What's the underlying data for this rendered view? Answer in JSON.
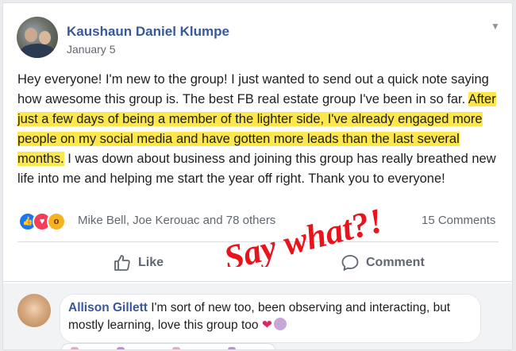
{
  "post": {
    "author": "Kaushaun Daniel Klumpe",
    "date": "January 5",
    "text_before": "Hey everyone! I'm new to the group! I just wanted to send out a quick note saying how awesome this group is. The best FB real estate group I've been in so far. ",
    "text_highlight": "After just a few days of being a member of the lighter side, I've already engaged more people on my social media and have gotten more leads than the last several months.",
    "text_after": " I was down about business and joining this group has really breathed new life into me and helping me start the year off right. Thank you to everyone!",
    "highlight_color": "#fde74c"
  },
  "reactions": {
    "types": [
      "like",
      "love",
      "wow"
    ],
    "names": "Mike Bell, Joe Kerouac and 78 others",
    "comments_count": "15 Comments"
  },
  "actions": {
    "like_label": "Like",
    "comment_label": "Comment"
  },
  "overlay": {
    "text": "Say what?!",
    "color": "#e8141b"
  },
  "comment": {
    "author": "Allison Gillett",
    "text": " I'm sort of new too, been observing and interacting, but mostly learning, love this group too "
  },
  "icons": {
    "chevron": "chevron-down-icon",
    "like": "thumbs-up-icon",
    "comment": "comment-bubble-icon"
  },
  "colors": {
    "link_blue": "#385898",
    "background": "#e9ebee"
  }
}
